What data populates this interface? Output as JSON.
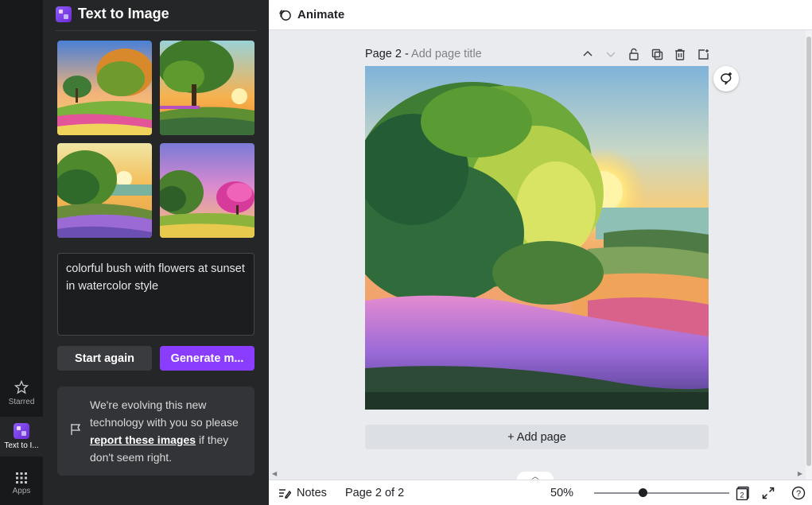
{
  "rail": {
    "items": [
      {
        "label": "Starred",
        "icon": "star-icon"
      },
      {
        "label": "Text to I...",
        "icon": "text-to-image-icon"
      },
      {
        "label": "Apps",
        "icon": "apps-grid-icon"
      }
    ]
  },
  "panel": {
    "title": "Text to Image",
    "prompt_text": "colorful bush with flowers at sunset in watercolor style",
    "start_again_label": "Start again",
    "generate_label": "Generate m...",
    "notice": {
      "before": "We're evolving this new technology with you so please ",
      "link": "report these images",
      "after": " if they don't seem right."
    }
  },
  "topbar": {
    "animate_label": "Animate"
  },
  "canvas": {
    "page_label": "Page 2 - ",
    "page_title_placeholder": "Add page title",
    "add_page_label": "+ Add page"
  },
  "bottombar": {
    "notes_label": "Notes",
    "page_indicator": "Page 2 of 2",
    "zoom_level": "50%",
    "zoom_fraction": 0.36,
    "pages_count_badge": "2",
    "help_label": "?"
  },
  "colors": {
    "accent": "#8b3dff",
    "panel_bg": "#252627",
    "rail_bg": "#18191b"
  }
}
